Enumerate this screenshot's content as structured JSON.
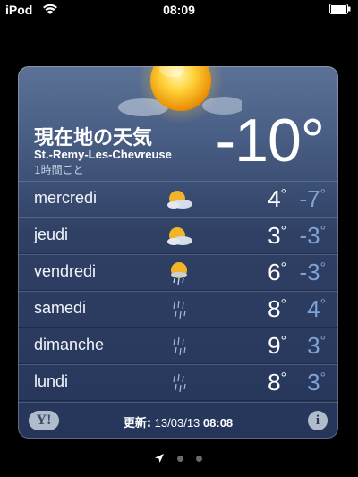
{
  "status_bar": {
    "carrier": "iPod",
    "time": "08:09"
  },
  "weather": {
    "city": "現在地の天気",
    "location": "St.-Remy-Les-Chevreuse",
    "interval": "1時間ごと",
    "current_temp": "-10°",
    "forecast": [
      {
        "day": "mercredi",
        "icon": "partly-cloudy-icon",
        "hi": "4",
        "lo": "-7"
      },
      {
        "day": "jeudi",
        "icon": "partly-cloudy-icon",
        "hi": "3",
        "lo": "-3"
      },
      {
        "day": "vendredi",
        "icon": "sun-rain-icon",
        "hi": "6",
        "lo": "-3"
      },
      {
        "day": "samedi",
        "icon": "rain-icon",
        "hi": "8",
        "lo": "4"
      },
      {
        "day": "dimanche",
        "icon": "rain-icon",
        "hi": "9",
        "lo": "3"
      },
      {
        "day": "lundi",
        "icon": "rain-icon",
        "hi": "8",
        "lo": "3"
      }
    ]
  },
  "footer": {
    "yahoo_logo": "Y!",
    "update_label": "更新:",
    "update_date": "13/03/13",
    "update_time": "08:08",
    "info": "i"
  },
  "colors": {
    "low_temp": "#7fa3d6",
    "card_top": "#5c7196",
    "card_bottom": "#26365a"
  }
}
